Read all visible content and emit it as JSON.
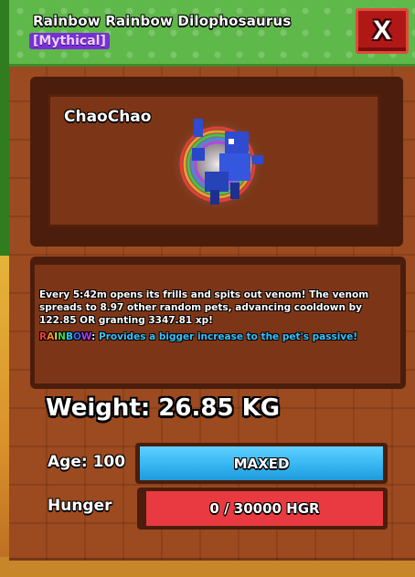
{
  "header": {
    "title": "Rainbow Rainbow Dilophosaurus",
    "rarity": "[Mythical]",
    "close_label": "X"
  },
  "pet": {
    "name": "ChaoChao"
  },
  "description": {
    "text": "Every 5:42m opens its frills and spits out venom! The venom spreads to 8.97 other random pets, advancing cooldown by 122.85 OR granting 3347.81 xp!",
    "rainbow_label": "RAINBOW",
    "rainbow_text": "Provides a bigger increase to the pet's passive!"
  },
  "stats": {
    "weight": "Weight: 26.85 KG",
    "age_label": "Age: 100",
    "age_bar_text": "MAXED",
    "age_progress": 1.0,
    "hunger_label": "Hunger",
    "hunger_bar_text": "0 / 30000 HGR",
    "hunger_progress": 0.0
  },
  "colors": {
    "header_green": "#5fb84a",
    "rarity_purple": "#7a2fd6",
    "close_red": "#b01818",
    "panel_brown": "#9c4a1f",
    "age_blue": "#35b6f2",
    "hunger_red": "#e83a40",
    "passive_blue": "#38c4ff"
  }
}
